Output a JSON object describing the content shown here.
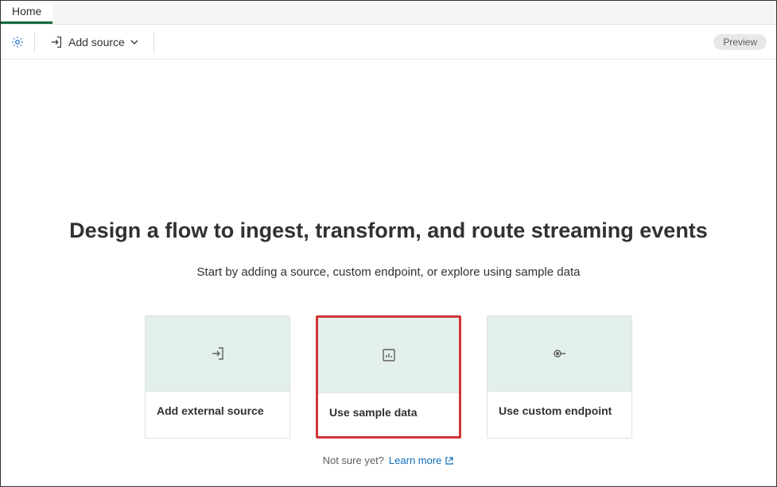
{
  "tabs": {
    "home": "Home"
  },
  "toolbar": {
    "add_source_label": "Add source",
    "preview_badge": "Preview"
  },
  "main": {
    "heading": "Design a flow to ingest, transform, and route streaming events",
    "subtitle": "Start by adding a source, custom endpoint, or explore using sample data",
    "cards": [
      {
        "title": "Add external source"
      },
      {
        "title": "Use sample data"
      },
      {
        "title": "Use custom endpoint"
      }
    ],
    "footer_prompt": "Not sure yet?",
    "learn_more": "Learn more"
  }
}
